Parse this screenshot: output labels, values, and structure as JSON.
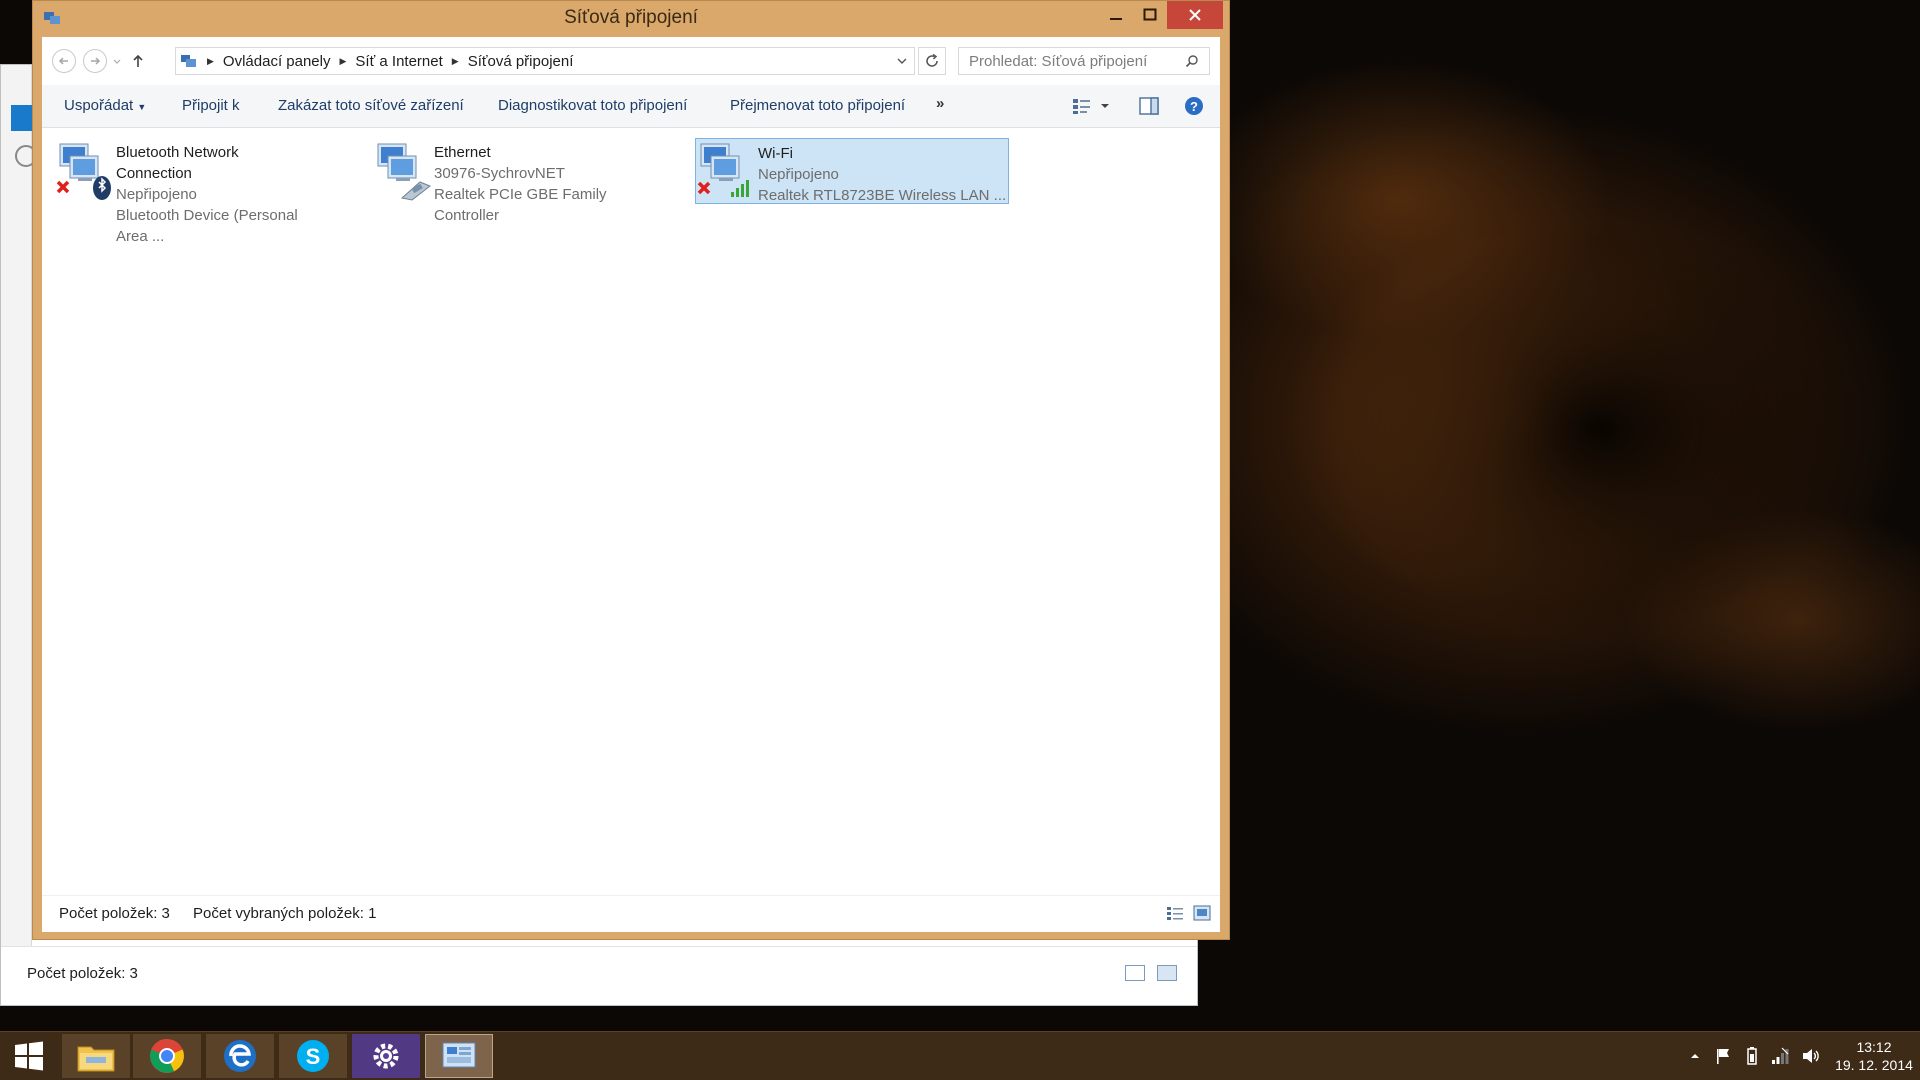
{
  "window": {
    "title": "Síťová připojení"
  },
  "nav": {
    "breadcrumbs": [
      "Ovládací panely",
      "Síť a Internet",
      "Síťová připojení"
    ],
    "search_placeholder": "Prohledat: Síťová připojení"
  },
  "toolbar": {
    "organize": "Uspořádat",
    "connect": "Připojit k",
    "disable": "Zakázat toto síťové zařízení",
    "diagnose": "Diagnostikovat toto připojení",
    "rename": "Přejmenovat toto připojení",
    "more": "»"
  },
  "connections": [
    {
      "name": "Bluetooth Network Connection",
      "status": "Nepřipojeno",
      "device": "Bluetooth Device (Personal Area ...",
      "icon": "bluetooth-network-icon",
      "selected": false
    },
    {
      "name": "Ethernet",
      "status": "30976-SychrovNET",
      "device": "Realtek PCIe GBE Family Controller",
      "icon": "ethernet-network-icon",
      "selected": false
    },
    {
      "name": "Wi-Fi",
      "status": "Nepřipojeno",
      "device": "Realtek RTL8723BE Wireless LAN ...",
      "icon": "wifi-network-icon",
      "selected": true
    }
  ],
  "statusbar": {
    "count": "Počet položek: 3",
    "selected": "Počet vybraných položek: 1"
  },
  "background_window": {
    "status": "Počet položek: 3"
  },
  "taskbar": {
    "apps": [
      "start-icon",
      "file-explorer-icon",
      "chrome-icon",
      "edge-like-icon",
      "skype-icon",
      "settings-icon",
      "control-panel-icon"
    ]
  },
  "clock": {
    "time": "13:12",
    "date": "19. 12. 2014"
  },
  "colors": {
    "accent": "#d9a86a",
    "selection": "#cde4f7",
    "close": "#c7463a"
  }
}
